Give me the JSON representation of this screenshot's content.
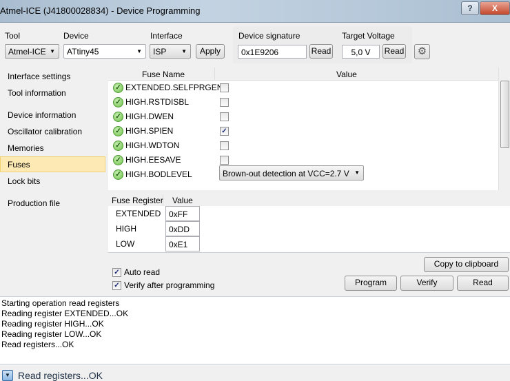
{
  "window": {
    "title": "Atmel-ICE (J41800028834) - Device Programming",
    "help": "?",
    "close": "X"
  },
  "toolbar": {
    "tool_label": "Tool",
    "tool_value": "Atmel-ICE",
    "device_label": "Device",
    "device_value": "ATtiny45",
    "interface_label": "Interface",
    "interface_value": "ISP",
    "apply": "Apply",
    "signature_label": "Device signature",
    "signature_value": "0x1E9206",
    "signature_read": "Read",
    "voltage_label": "Target Voltage",
    "voltage_value": "5,0 V",
    "voltage_read": "Read",
    "settings_icon": "gear-icon"
  },
  "sidebar": {
    "items": [
      {
        "label": "Interface settings"
      },
      {
        "label": "Tool information"
      },
      {
        "label": "Device information"
      },
      {
        "label": "Oscillator calibration"
      },
      {
        "label": "Memories"
      },
      {
        "label": "Fuses",
        "selected": true
      },
      {
        "label": "Lock bits"
      },
      {
        "label": "Production file"
      }
    ]
  },
  "fuses": {
    "col_name": "Fuse Name",
    "col_value": "Value",
    "rows": [
      {
        "name": "EXTENDED.SELFPRGEN",
        "checked": false
      },
      {
        "name": "HIGH.RSTDISBL",
        "checked": false
      },
      {
        "name": "HIGH.DWEN",
        "checked": false
      },
      {
        "name": "HIGH.SPIEN",
        "checked": true
      },
      {
        "name": "HIGH.WDTON",
        "checked": false
      },
      {
        "name": "HIGH.EESAVE",
        "checked": false
      },
      {
        "name": "HIGH.BODLEVEL",
        "select": "Brown-out detection at VCC=2.7 V"
      }
    ]
  },
  "registers": {
    "col_name": "Fuse Register",
    "col_value": "Value",
    "rows": [
      {
        "name": "EXTENDED",
        "value": "0xFF"
      },
      {
        "name": "HIGH",
        "value": "0xDD"
      },
      {
        "name": "LOW",
        "value": "0xE1"
      }
    ]
  },
  "options": {
    "auto_read": "Auto read",
    "auto_read_checked": true,
    "verify": "Verify after programming",
    "verify_checked": true
  },
  "actions": {
    "copy": "Copy to clipboard",
    "program": "Program",
    "verify": "Verify",
    "read": "Read"
  },
  "log": [
    "Starting operation read registers",
    "Reading register EXTENDED...OK",
    "Reading register HIGH...OK",
    "Reading register LOW...OK",
    "Read registers...OK"
  ],
  "status": {
    "text": "Read registers...OK"
  }
}
